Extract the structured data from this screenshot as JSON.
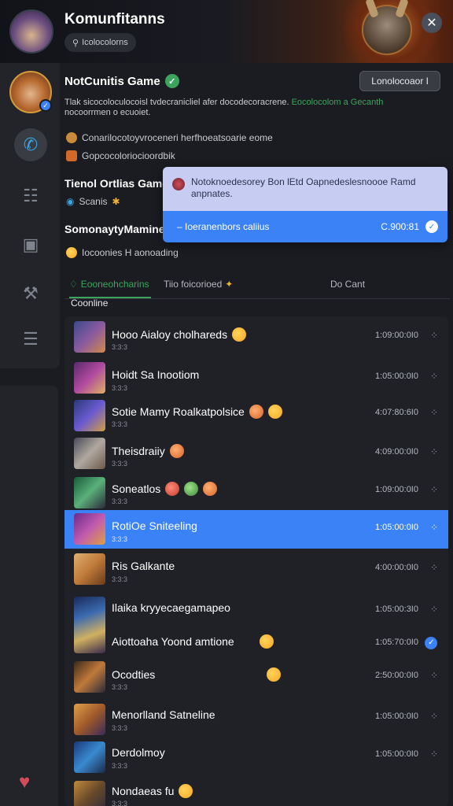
{
  "header": {
    "title": "Komunfitanns",
    "search_placeholder": "Icolocolorns",
    "close_label": "✕"
  },
  "server": {
    "name": "NotCunitis Game",
    "action_label": "Lonolocoaor I",
    "description": "Tlak sicocoloculocoisl tvdecranicliel afer docodecoracrene.",
    "description_accent": "Eocolocolom a Gecanth",
    "description_line2": "nocoorrmen o ecuoiet.",
    "info1": "Conarilocotoyvroceneri herfhoeatsoarie eome",
    "info2": "Gopcocoloriocioordbik"
  },
  "sections": {
    "section1_title": "Tienol Ortlias Game",
    "section1_sub": "Scanis",
    "section2_title": "SomonaytyMamine",
    "section2_sub": "Iocoonies H aonoading"
  },
  "popup": {
    "message": "Notoknoedesorey Bon lEtd Oapnedeslesnoooe Ramd anpnates.",
    "action": "Ioeranenbors caliius",
    "time": "C.900:81"
  },
  "tabs": [
    {
      "label": "Eooneohcharins"
    },
    {
      "label": "Tiio foicorioed"
    },
    {
      "label": "Do Cant"
    }
  ],
  "list_heading": "Coonline",
  "rows": [
    {
      "title": "Hooo Aialoy cholhareds",
      "sub": "3:3:3",
      "time": "1:09:00:0I0"
    },
    {
      "title": "Hoidt Sa Inootiom",
      "sub": "3:3:3",
      "time": "1:05:00:0I0"
    },
    {
      "title": "Sotie Mamy Roalkatpolsice",
      "sub": "3:3:3",
      "time": "4:07:80:6I0"
    },
    {
      "title": "Theisdraiiy",
      "sub": "3:3:3",
      "time": "4:09:00:0I0"
    },
    {
      "title": "Soneatlos",
      "sub": "3:3:3",
      "time": "1:09:00:0I0"
    },
    {
      "title": "RotiOe Sniteeling",
      "sub": "3:3:3",
      "time": "1:05:00:0I0"
    },
    {
      "title": "Ris Galkante",
      "sub": "3:3:3",
      "time": "4:00:00:0I0"
    },
    {
      "title": "Ilaika kryyecaegamapeo",
      "sub": "",
      "time": "1:05:00:3I0"
    },
    {
      "title": "Aiottoaha Yoond amtione",
      "sub": "",
      "time": "1:05:70:0I0"
    },
    {
      "title": "Ocodties",
      "sub": "3:3:3",
      "time": "2:50:00:0I0"
    },
    {
      "title": "Menorlland Satneline",
      "sub": "3:3:3",
      "time": "1:05:00:0I0"
    },
    {
      "title": "Derdolmoy",
      "sub": "3:3:3",
      "time": "1:05:00:0I0"
    },
    {
      "title": "Nondaeas fu",
      "sub": "3:3:3",
      "time": ""
    }
  ],
  "colors": {
    "accent_blue": "#3b82f6",
    "accent_green": "#3ba55d",
    "background": "#1b1c21"
  }
}
